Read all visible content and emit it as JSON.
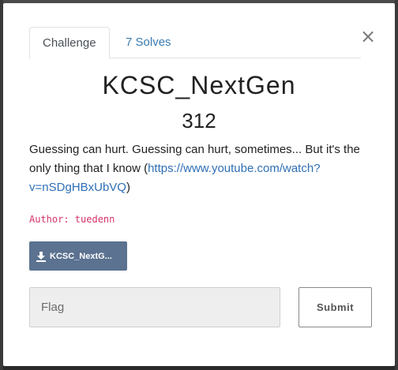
{
  "modal": {
    "close_label": "×",
    "tabs": [
      {
        "label": "Challenge"
      },
      {
        "label": "7 Solves"
      }
    ],
    "title": "KCSC_NextGen",
    "value": "312",
    "description_text": "Guessing can hurt. Guessing can hurt, sometimes... But it's the only thing that I know (",
    "description_link": "https://www.youtube.com/watch?v=nSDgHBxUbVQ",
    "description_end": ")",
    "author": "Author: tuedenn",
    "file_button_label": "KCSC_NextG...",
    "flag_placeholder": "Flag",
    "submit_label": "Submit"
  }
}
